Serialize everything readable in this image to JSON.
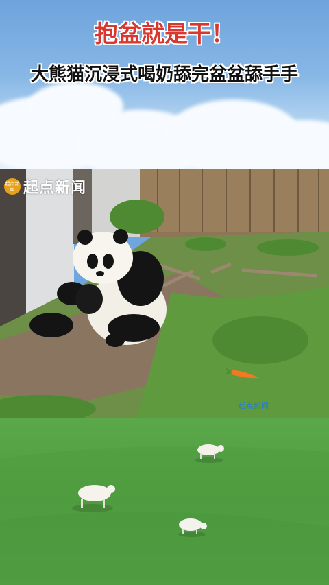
{
  "header": {
    "title": "抱盆就是干！",
    "subtitle": "大熊猫沉浸式喝奶舔完盆盆舔手手"
  },
  "video": {
    "source_logo_text": "起点新闻",
    "logo_badge_text": "起点新闻",
    "corner_mark": "起点新闻"
  },
  "icons": [
    "panda",
    "carrot",
    "goat",
    "sheep"
  ],
  "colors": {
    "title_red": "#d8382f",
    "subtitle_black": "#111111",
    "grass_green": "#55a347",
    "logo_orange": "#e8a11b"
  }
}
